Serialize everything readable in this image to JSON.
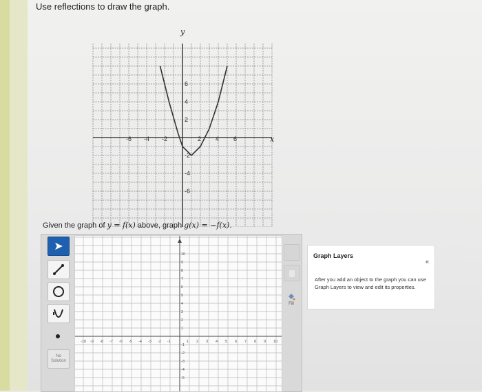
{
  "instruction": "Use reflections to draw the graph.",
  "reference_graph": {
    "x_axis_label": "x",
    "y_axis_label": "y",
    "x_ticks": [
      "-6",
      "-4",
      "-2",
      "2",
      "4",
      "6"
    ],
    "y_ticks": [
      "6",
      "4",
      "2",
      "-2",
      "-4",
      "-6"
    ],
    "curve_points": [
      [
        -2.5,
        8
      ],
      [
        -1.5,
        4
      ],
      [
        -0.5,
        0.5
      ],
      [
        0,
        -1
      ],
      [
        1,
        -2
      ],
      [
        2,
        -1
      ],
      [
        3,
        1
      ],
      [
        4,
        4
      ],
      [
        5,
        8
      ]
    ]
  },
  "question": {
    "prefix": "Given the graph of ",
    "f_expr": "y = f(x)",
    "middle": " above, graph ",
    "g_expr": "g(x) = −f(x)",
    "suffix": "."
  },
  "tools": {
    "pointer_icon": "pointer-arrow-icon",
    "line_icon": "line-tool-icon",
    "circle_icon": "circle-tool-icon",
    "parabola_icon": "parabola-tool-icon",
    "point_icon": "point-tool-icon",
    "no_solution_label": "No Solution"
  },
  "answer_grid": {
    "x_ticks": [
      "-10",
      "-9",
      "-8",
      "-7",
      "-6",
      "-5",
      "-4",
      "-3",
      "-2",
      "-1",
      "1",
      "2",
      "3",
      "4",
      "5",
      "6",
      "7",
      "8",
      "9",
      "10"
    ],
    "y_ticks": [
      "10",
      "9",
      "8",
      "7",
      "6",
      "5",
      "4",
      "3",
      "2",
      "1",
      "-1",
      "-2",
      "-3",
      "-4",
      "-5"
    ]
  },
  "side_buttons": {
    "fill_label": "Fill"
  },
  "graph_layers": {
    "title": "Graph Layers",
    "collapse_glyph": "«",
    "description": "After you add an object to the graph you can use Graph Layers to view and edit its properties."
  }
}
